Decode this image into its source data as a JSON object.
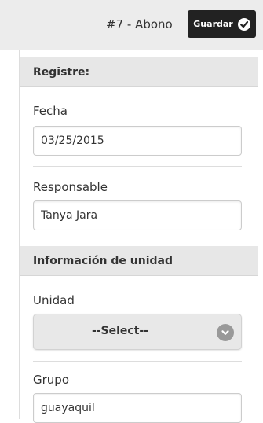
{
  "header": {
    "title": "#7 - Abono",
    "save_label": "Guardar"
  },
  "sections": {
    "registre": {
      "title": "Registre:"
    },
    "unidad_info": {
      "title": "Información de unidad"
    }
  },
  "fields": {
    "fecha": {
      "label": "Fecha",
      "value": "03/25/2015"
    },
    "responsable": {
      "label": "Responsable",
      "value": "Tanya Jara"
    },
    "unidad": {
      "label": "Unidad",
      "selected": "--Select--"
    },
    "grupo": {
      "label": "Grupo",
      "value": "guayaquil"
    }
  },
  "icons": {
    "save": "check-icon",
    "select": "chevron-down-icon"
  },
  "colors": {
    "header_bg": "#ececec",
    "button_bg": "#222222",
    "section_bg": "#e7e7e7"
  }
}
